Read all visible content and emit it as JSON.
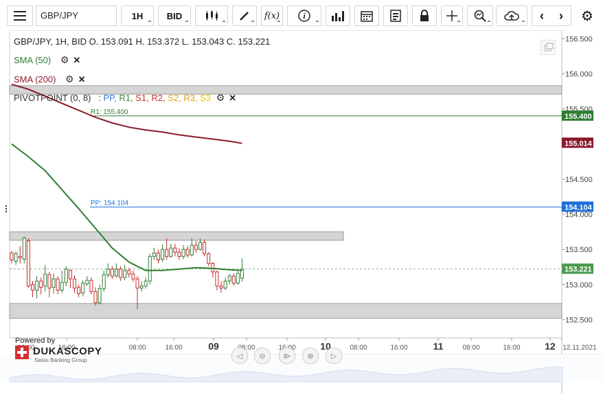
{
  "toolbar": {
    "symbol": "GBP/JPY",
    "timeframe": "1H",
    "price_type": "BID",
    "fx_label": "f(x)"
  },
  "legend": {
    "ohlc": "GBP/JPY, 1H, BID   O. 153.091  H. 153.372  L. 153.043  C. 153.221",
    "sma50": "SMA (50)",
    "sma200": "SMA (200)",
    "pivot_prefix": "PIVOTPOINT (0, 8)   : ",
    "pivot_items": [
      {
        "label": "PP",
        "color": "#3b78d8"
      },
      {
        "label": "R1",
        "color": "#3a8a3a"
      },
      {
        "label": "S1",
        "color": "#c0392b"
      },
      {
        "label": "R2",
        "color": "#c0392b"
      },
      {
        "label": "S2",
        "color": "#e8a020"
      },
      {
        "label": "R3",
        "color": "#e8a020"
      },
      {
        "label": "S3",
        "color": "#e8c800"
      }
    ]
  },
  "branding": {
    "powered_by": "Powered by",
    "brand": "DUKASCOPY",
    "sub": "Swiss Banking Group"
  },
  "colors": {
    "up": "#2e7d32",
    "down": "#c62828",
    "sma50": "#2e7d32",
    "sma200": "#8b1a2b",
    "r1": "#2e7d32",
    "pp": "#1e6fd9",
    "last": "#2e7d32"
  },
  "chart_data": {
    "type": "candlestick",
    "symbol": "GBP/JPY",
    "timeframe": "1H",
    "y_ticks": [
      156.5,
      156.0,
      155.5,
      155.0,
      154.5,
      154.0,
      153.5,
      153.0,
      152.5
    ],
    "y_tick_labels": [
      "156.500",
      "156.000",
      "155.500",
      "155.000",
      "154.500",
      "154.000",
      "153.500",
      "153.000",
      "152.500"
    ],
    "ylim": [
      152.24,
      156.62
    ],
    "x_tick_labels": [
      "08:00",
      "16:00",
      "08:00",
      "16:00",
      "09",
      "08:00",
      "16:00",
      "10",
      "08:00",
      "16:00",
      "11",
      "08:00",
      "16:00",
      "12",
      "12.11.2021"
    ],
    "bold_x_labels": [
      "09",
      "10",
      "11",
      "12"
    ],
    "level_labels": {
      "r1": {
        "text": "R1: 155.400",
        "value": 155.4,
        "tag": "155.400"
      },
      "pp": {
        "text": "PP: 154.104",
        "value": 154.104,
        "tag": "154.104"
      },
      "sma200_tag": {
        "value": 155.014,
        "tag": "155.014"
      },
      "last_price": {
        "value": 153.221,
        "tag": "153.221"
      }
    },
    "zones": [
      {
        "from": 155.71,
        "to": 155.83,
        "x_end": "full"
      },
      {
        "from": 153.63,
        "to": 153.75,
        "x_end": "partial"
      },
      {
        "from": 152.52,
        "to": 152.73,
        "x_end": "full"
      }
    ],
    "candles": [
      [
        153.45,
        153.35,
        153.48,
        153.3
      ],
      [
        153.33,
        153.44,
        153.47,
        153.28
      ],
      [
        153.4,
        153.38,
        153.55,
        153.3
      ],
      [
        153.36,
        153.66,
        153.68,
        153.3
      ],
      [
        153.62,
        152.98,
        153.66,
        152.95
      ],
      [
        153.0,
        152.92,
        153.05,
        152.82
      ],
      [
        152.92,
        153.05,
        153.12,
        152.8
      ],
      [
        153.05,
        152.96,
        153.1,
        152.86
      ],
      [
        152.98,
        153.15,
        153.28,
        152.9
      ],
      [
        153.14,
        152.95,
        153.18,
        152.82
      ],
      [
        152.96,
        153.08,
        153.16,
        152.87
      ],
      [
        153.08,
        152.92,
        153.12,
        152.86
      ],
      [
        152.92,
        153.03,
        153.2,
        152.88
      ],
      [
        153.03,
        153.22,
        153.26,
        152.98
      ],
      [
        153.2,
        153.08,
        153.22,
        152.95
      ],
      [
        153.08,
        152.95,
        153.13,
        152.88
      ],
      [
        152.96,
        152.87,
        153.0,
        152.82
      ],
      [
        152.88,
        153.02,
        153.06,
        152.83
      ],
      [
        153.01,
        153.06,
        153.12,
        152.98
      ],
      [
        153.06,
        152.9,
        153.1,
        152.86
      ],
      [
        152.9,
        152.74,
        152.96,
        152.7
      ],
      [
        152.74,
        152.94,
        153.0,
        152.72
      ],
      [
        152.94,
        153.14,
        153.2,
        152.9
      ],
      [
        153.14,
        153.22,
        153.3,
        153.1
      ],
      [
        153.22,
        153.12,
        153.26,
        153.08
      ],
      [
        153.12,
        153.22,
        153.3,
        153.1
      ],
      [
        153.22,
        153.1,
        153.26,
        153.05
      ],
      [
        153.1,
        153.2,
        153.28,
        153.06
      ],
      [
        153.2,
        153.15,
        153.24,
        153.1
      ],
      [
        153.15,
        153.08,
        153.2,
        153.04
      ],
      [
        153.08,
        152.95,
        153.12,
        152.65
      ],
      [
        152.95,
        152.98,
        153.05,
        152.9
      ],
      [
        152.98,
        153.05,
        153.1,
        152.94
      ],
      [
        153.05,
        153.4,
        153.44,
        153.0
      ],
      [
        153.4,
        153.45,
        153.52,
        153.35
      ],
      [
        153.45,
        153.35,
        153.5,
        153.3
      ],
      [
        153.36,
        153.5,
        153.57,
        153.32
      ],
      [
        153.5,
        153.4,
        153.66,
        153.35
      ],
      [
        153.4,
        153.52,
        153.58,
        153.38
      ],
      [
        153.52,
        153.46,
        153.58,
        153.4
      ],
      [
        153.46,
        153.4,
        153.52,
        153.35
      ],
      [
        153.4,
        153.5,
        153.56,
        153.36
      ],
      [
        153.5,
        153.42,
        153.55,
        153.38
      ],
      [
        153.42,
        153.56,
        153.66,
        153.4
      ],
      [
        153.56,
        153.5,
        153.62,
        153.45
      ],
      [
        153.5,
        153.6,
        153.65,
        153.48
      ],
      [
        153.6,
        153.44,
        153.64,
        153.4
      ],
      [
        153.44,
        153.3,
        153.46,
        153.26
      ],
      [
        153.3,
        153.18,
        153.32,
        153.1
      ],
      [
        153.18,
        152.98,
        153.2,
        152.92
      ],
      [
        152.98,
        152.95,
        153.05,
        152.88
      ],
      [
        152.95,
        153.05,
        153.1,
        152.92
      ],
      [
        153.05,
        153.12,
        153.15,
        153.0
      ],
      [
        153.12,
        153.02,
        153.16,
        152.98
      ],
      [
        153.02,
        153.16,
        153.19,
        153.0
      ],
      [
        153.09,
        153.22,
        153.37,
        153.04
      ]
    ],
    "sma50": [
      [
        0,
        155.0
      ],
      [
        4,
        154.82
      ],
      [
        8,
        154.62
      ],
      [
        12,
        154.35
      ],
      [
        16,
        154.08
      ],
      [
        20,
        153.8
      ],
      [
        24,
        153.52
      ],
      [
        28,
        153.32
      ],
      [
        32,
        153.2
      ],
      [
        36,
        153.2
      ],
      [
        40,
        153.22
      ],
      [
        44,
        153.24
      ],
      [
        48,
        153.23
      ],
      [
        52,
        153.21
      ],
      [
        55,
        153.2
      ]
    ],
    "sma200": [
      [
        0,
        155.85
      ],
      [
        4,
        155.78
      ],
      [
        8,
        155.68
      ],
      [
        12,
        155.58
      ],
      [
        16,
        155.48
      ],
      [
        20,
        155.38
      ],
      [
        24,
        155.3
      ],
      [
        28,
        155.24
      ],
      [
        32,
        155.2
      ],
      [
        36,
        155.17
      ],
      [
        40,
        155.13
      ],
      [
        44,
        155.1
      ],
      [
        48,
        155.07
      ],
      [
        52,
        155.04
      ],
      [
        55,
        155.01
      ]
    ]
  }
}
